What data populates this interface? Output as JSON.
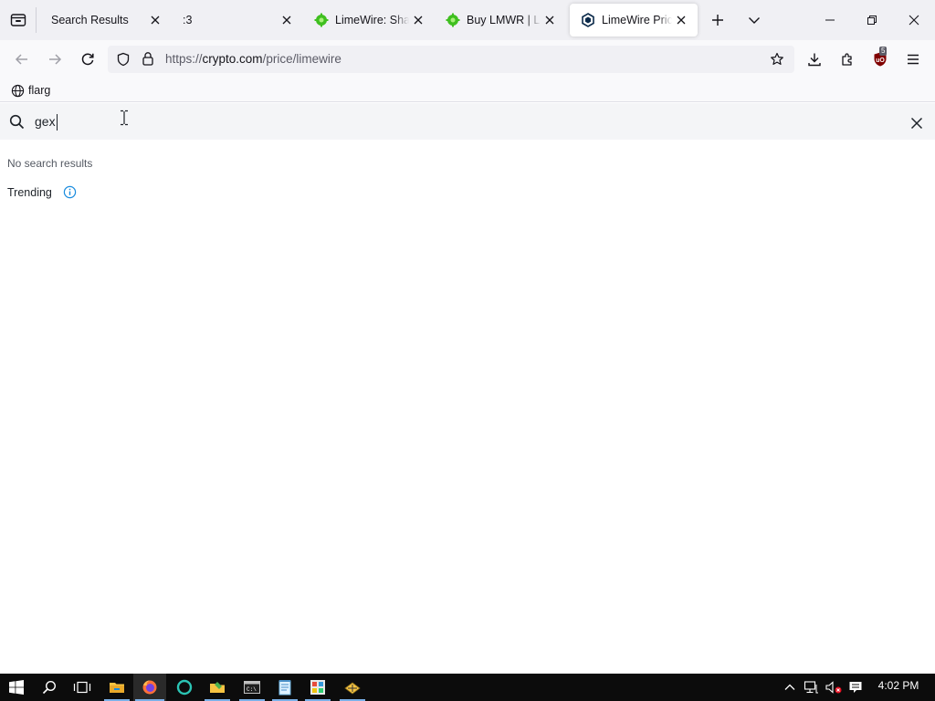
{
  "browser": {
    "tabs": [
      {
        "title": "Search Results",
        "favicon": "none",
        "active": false
      },
      {
        "title": ":3",
        "favicon": "none",
        "active": false
      },
      {
        "title": "LimeWire: Share",
        "favicon": "limewire-green-icon",
        "active": false
      },
      {
        "title": "Buy LMWR | LimeWire",
        "favicon": "limewire-green-icon",
        "active": false
      },
      {
        "title": "LimeWire Price | LMWR",
        "favicon": "crypto-com-icon",
        "active": true
      }
    ],
    "url": {
      "prefix": "https://",
      "host": "crypto.com",
      "path": "/price/limewire"
    },
    "extension_badge": "5",
    "bookmarks": [
      {
        "label": "flarg",
        "icon": "globe-icon"
      }
    ]
  },
  "page": {
    "search": {
      "value": "gex",
      "placeholder": ""
    },
    "no_results_text": "No search results",
    "trending_label": "Trending"
  },
  "taskbar": {
    "clock": "4:02 PM",
    "apps": [
      "file-explorer-icon",
      "firefox-icon",
      "edge-icon",
      "folder-tool-icon",
      "terminal-icon",
      "notepad-icon",
      "control-panel-icon",
      "network-tool-icon"
    ]
  },
  "colors": {
    "accent": "#1a8cde",
    "tab_strip": "#f0f0f4",
    "taskbar": "#0c0c0c",
    "limewire_green": "#3fbf1f"
  }
}
